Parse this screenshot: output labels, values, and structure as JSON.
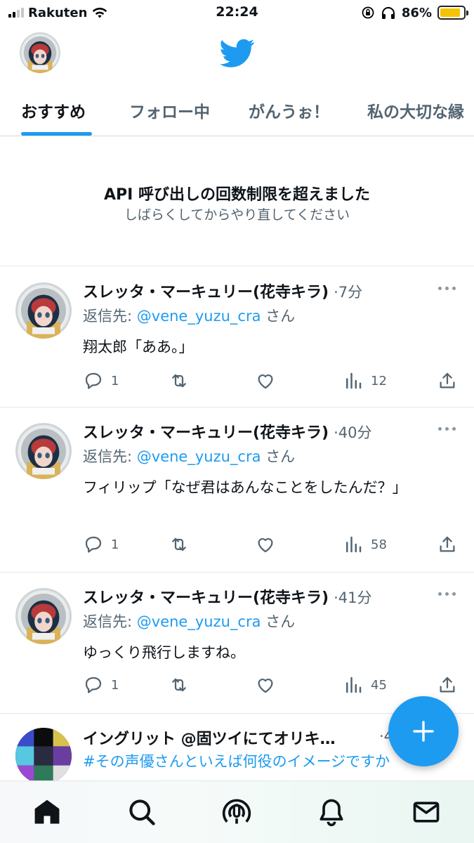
{
  "status_bar": {
    "carrier": "Rakuten",
    "time": "22:24",
    "battery": "86%",
    "battery_level": 0.86
  },
  "tabs": [
    {
      "label": "おすすめ",
      "active": true
    },
    {
      "label": "フォロー中",
      "active": false
    },
    {
      "label": "がんうぉ！",
      "active": false
    },
    {
      "label": "私の大切な縁",
      "active": false
    }
  ],
  "error": {
    "title": "API 呼び出しの回数制限を超えました",
    "subtitle": "しばらくしてからやり直してください"
  },
  "tweets": [
    {
      "name": "スレッタ・マーキュリー(花寺キラ)",
      "time": "·7分",
      "reply_prefix": "返信先: ",
      "reply_handle": "@vene_yuzu_cra",
      "reply_suffix": " さん",
      "text": "翔太郎「ああ。」",
      "replies": "1",
      "retweets": "",
      "likes": "",
      "views": "12"
    },
    {
      "name": "スレッタ・マーキュリー(花寺キラ)",
      "time": "·40分",
      "reply_prefix": "返信先: ",
      "reply_handle": "@vene_yuzu_cra",
      "reply_suffix": " さん",
      "text": "フィリップ「なぜ君はあんなことをしたんだ？」",
      "replies": "1",
      "retweets": "",
      "likes": "",
      "views": "58"
    },
    {
      "name": "スレッタ・マーキュリー(花寺キラ)",
      "time": "·41分",
      "reply_prefix": "返信先: ",
      "reply_handle": "@vene_yuzu_cra",
      "reply_suffix": " さん",
      "text": "ゆっくり飛行しますね。",
      "replies": "1",
      "retweets": "",
      "likes": "",
      "views": "45"
    },
    {
      "name": "イングリット @固ツイにてオリキ…",
      "time": "·4",
      "hashtag": "#その声優さんといえば何役のイメージですか"
    }
  ],
  "icons": {
    "header_avatar": "profile-avatar",
    "logo": "twitter-bird-icon",
    "fab": "compose-plus-icon",
    "nav": [
      "home-icon",
      "search-icon",
      "spaces-icon",
      "notifications-icon",
      "messages-icon"
    ]
  },
  "colors": {
    "accent": "#1d9bf0",
    "text": "#0f1419",
    "muted": "#536471",
    "battery": "#f5c400"
  }
}
